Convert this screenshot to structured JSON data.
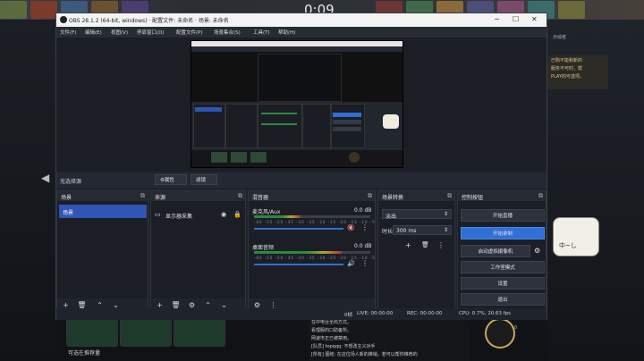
{
  "background": {
    "clock": "0:09",
    "right_top_text": "示威者",
    "right_banner_lines": [
      "已购不能和新的",
      "服务不可时，帮",
      "PLAY的可选项。"
    ],
    "mascot_text": "中~し",
    "hero_label": "可选在推荐量",
    "chat_lines": [
      "在中电台全局方式。",
      "看理服的口助备所。",
      "网速市正已被禁用。",
      "[队员] topqqq: 不想改主义对手",
      "[所有] 图结: 在这位场人新的推销，若可以帮你推荐的"
    ],
    "ring_text": "0"
  },
  "window": {
    "title": "OBS 28.1.2 (64-bit, windows) · 配置文件: 未命名 · 场景: 未命名",
    "menus": [
      "文件(F)",
      "编辑(E)",
      "视图(V)",
      "停靠窗口(D)",
      "配置文件(P)",
      "场景集合(S)",
      "工具(T)",
      "帮助(H)"
    ]
  },
  "source_bar": {
    "no_source": "无选择源",
    "properties": "⚙属性",
    "filters": "滤镜"
  },
  "scenes": {
    "title": "场景",
    "items": [
      "场景"
    ]
  },
  "sources": {
    "title": "来源",
    "items": [
      {
        "name": "显示器采集"
      }
    ]
  },
  "mixer": {
    "title": "混音器",
    "channels": [
      {
        "name": "麦克风/Aux",
        "db": "0.0 dB",
        "level": 0.4
      },
      {
        "name": "桌面音频",
        "db": "0.0 dB",
        "level": 0.75
      }
    ],
    "ticks": "-60 -55 -50 -45 -40 -35 -30 -25 -20 -15 -10 -5 0"
  },
  "transitions": {
    "title": "场景转换",
    "type": "淡出",
    "duration_label": "时长",
    "duration": "300 ms"
  },
  "controls": {
    "title": "控制按钮",
    "buttons": [
      "开始直播",
      "开始录制",
      "启动虚拟摄像机",
      "工作室模式",
      "设置",
      "退出"
    ]
  },
  "status": {
    "frames": "0帧",
    "live": "LIVE: 00:00:00",
    "rec": "REC: 00:00:00",
    "cpu": "CPU: 0.7%, 20.63 fps"
  }
}
